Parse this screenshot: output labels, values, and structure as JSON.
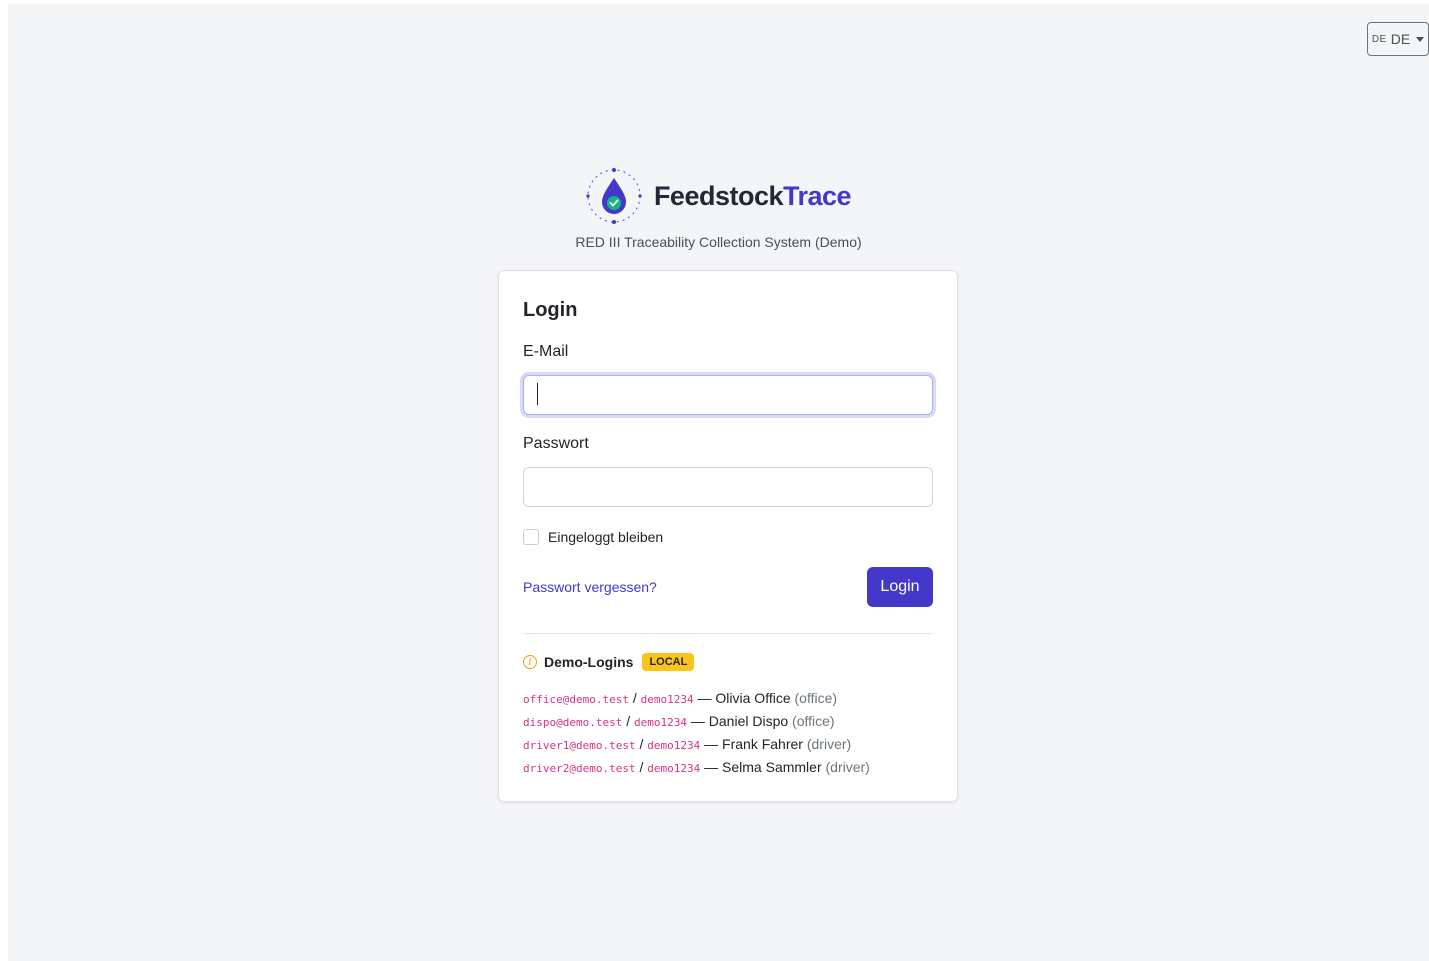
{
  "language": {
    "flag": "DE",
    "label": "DE"
  },
  "brand": {
    "part1": "Feedstock",
    "part2": "Trace",
    "subtitle": "RED III Traceability Collection System (Demo)"
  },
  "form": {
    "title": "Login",
    "email_label": "E-Mail",
    "email_value": "",
    "password_label": "Passwort",
    "password_value": "",
    "remember_label": "Eingeloggt bleiben",
    "remember_checked": false,
    "forgot_label": "Passwort vergessen?",
    "submit_label": "Login"
  },
  "demo": {
    "title": "Demo-Logins",
    "badge": "LOCAL",
    "accounts": [
      {
        "email": "office@demo.test",
        "password": "demo1234",
        "name": "Olivia Office",
        "role": "(office)"
      },
      {
        "email": "dispo@demo.test",
        "password": "demo1234",
        "name": "Daniel Dispo",
        "role": "(office)"
      },
      {
        "email": "driver1@demo.test",
        "password": "demo1234",
        "name": "Frank Fahrer",
        "role": "(driver)"
      },
      {
        "email": "driver2@demo.test",
        "password": "demo1234",
        "name": "Selma Sammler",
        "role": "(driver)"
      }
    ]
  },
  "colors": {
    "primary": "#4338ca",
    "badge": "#fcc419",
    "code": "#d63384",
    "background": "#f4f5f7"
  },
  "icons": {
    "logo": "droplet-check-icon",
    "info": "info-icon",
    "language_caret": "caret-down-icon"
  }
}
